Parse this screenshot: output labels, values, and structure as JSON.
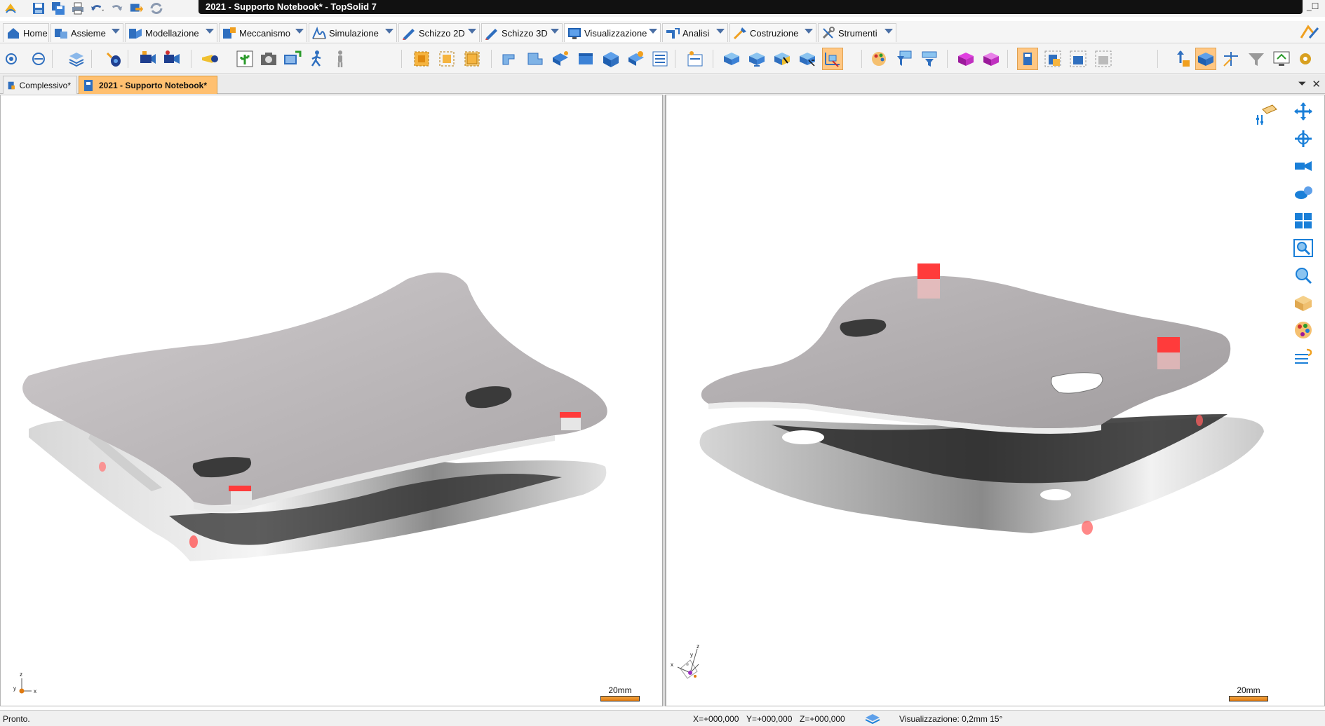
{
  "window": {
    "title": "2021 - Supporto Notebook* - TopSolid 7"
  },
  "ribbon": {
    "tabs": [
      {
        "label": "Home"
      },
      {
        "label": "Assieme"
      },
      {
        "label": "Modellazione"
      },
      {
        "label": "Meccanismo"
      },
      {
        "label": "Simulazione"
      },
      {
        "label": "Schizzo 2D"
      },
      {
        "label": "Schizzo 3D"
      },
      {
        "label": "Visualizzazione"
      },
      {
        "label": "Analisi"
      },
      {
        "label": "Costruzione"
      },
      {
        "label": "Strumenti"
      }
    ],
    "active_tab": "Visualizzazione"
  },
  "documents": {
    "tabs": [
      {
        "label": "Complessivo*"
      },
      {
        "label": "2021 - Supporto Notebook*"
      }
    ],
    "active": "2021 - Supporto Notebook*"
  },
  "viewports": {
    "left": {
      "scale_label": "20mm",
      "axis_labels": {
        "x": "x",
        "y": "y",
        "z": "z"
      }
    },
    "right": {
      "scale_label": "20mm",
      "axis_labels": {
        "x": "x",
        "y": "y",
        "z": "z"
      }
    }
  },
  "status": {
    "message": "Pronto.",
    "x": "X=+000,000",
    "y": "Y=+000,000",
    "z": "Z=+000,000",
    "visualization": "Visualizzazione: 0,2mm 15°"
  },
  "colors": {
    "accent": "#ffc070",
    "active_tab_highlight": "#ffc783",
    "model_surface": "#b8b4b6",
    "pad_red": "#ff3b3b",
    "icon_blue": "#2a78d0"
  },
  "icons": {
    "quick_access": [
      "app-logo-icon",
      "save-icon",
      "save-all-icon",
      "print-icon",
      "undo-icon",
      "redo-icon",
      "export-icon",
      "refresh-icon"
    ],
    "right_tools": [
      "pan-icon",
      "rotate-icon",
      "camera-icon",
      "orbit-icon",
      "view-layout-icon",
      "zoom-window-icon",
      "zoom-icon",
      "box-view-icon",
      "palette-icon",
      "help-lines-icon"
    ]
  }
}
